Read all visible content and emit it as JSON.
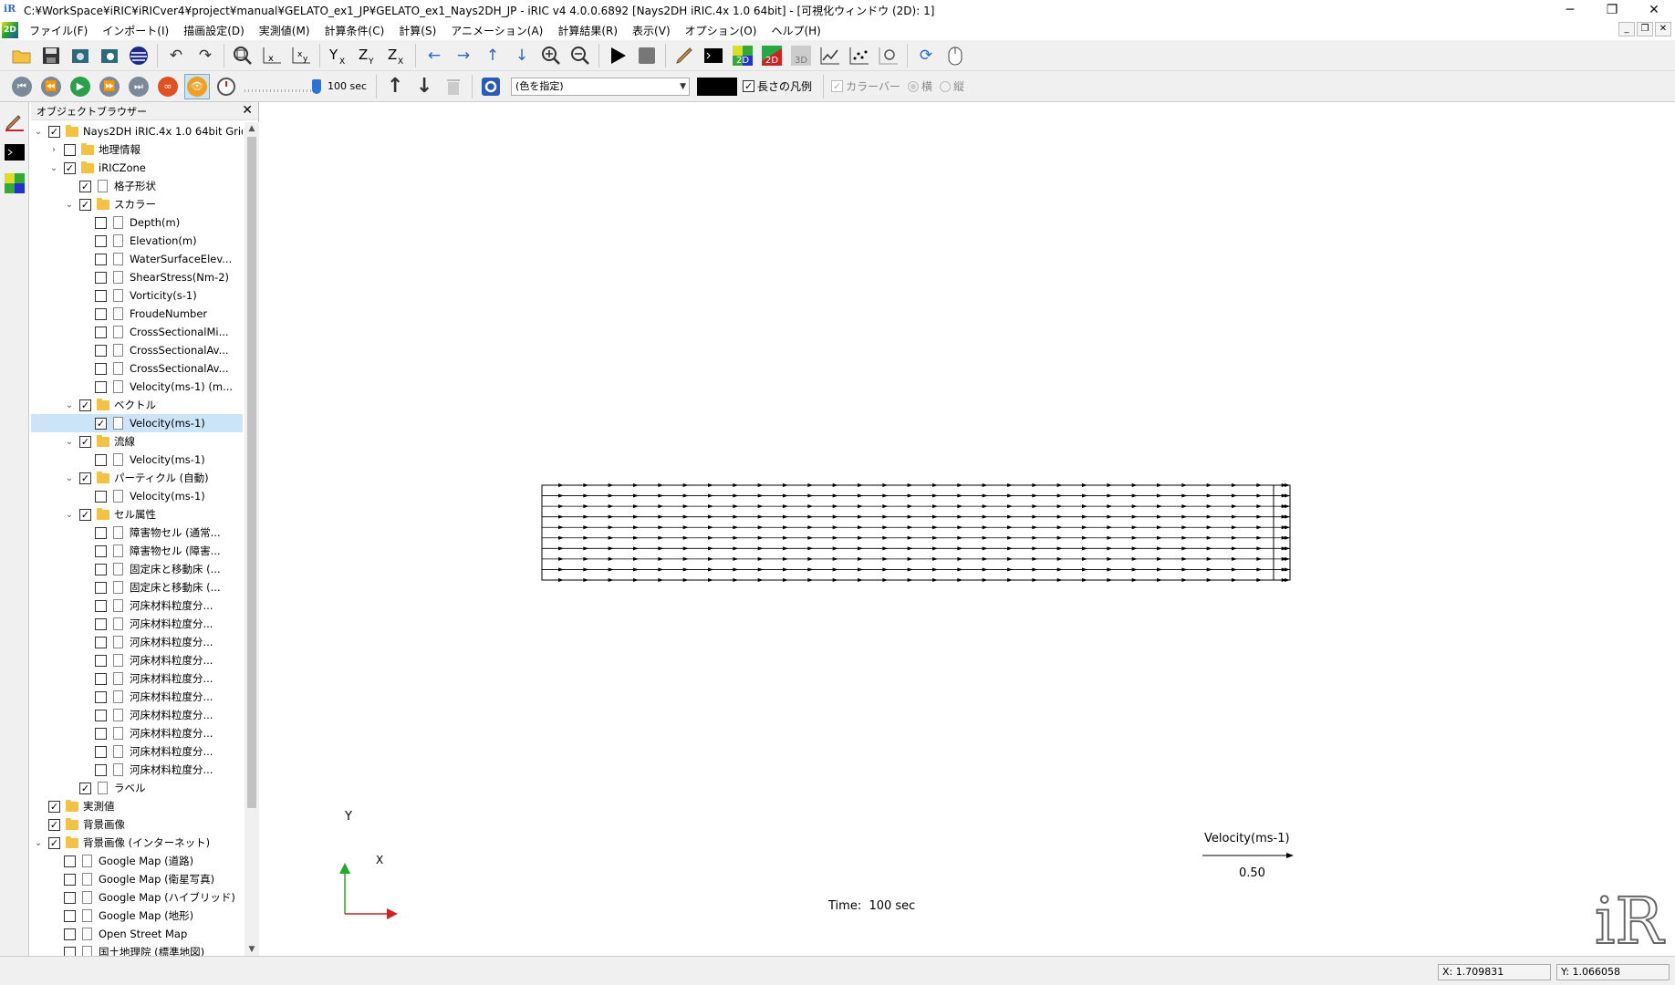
{
  "window": {
    "title": "C:¥WorkSpace¥iRIC¥iRICver4¥project¥manual¥GELATO_ex1_JP¥GELATO_ex1_Nays2DH_JP - iRIC v4 4.0.0.6892 [Nays2DH iRIC.4x 1.0 64bit] - [可視化ウィンドウ (2D): 1]",
    "app_icon": "iR",
    "minimize": "─",
    "maximize": "❐",
    "close": "✕"
  },
  "menu": {
    "logo": "2D",
    "items": [
      "ファイル(F)",
      "インポート(I)",
      "描画設定(D)",
      "実測値(M)",
      "計算条件(C)",
      "計算(S)",
      "アニメーション(A)",
      "計算結果(R)",
      "表示(V)",
      "オプション(O)",
      "ヘルプ(H)"
    ],
    "mdi_minimize": "_",
    "mdi_restore": "❐",
    "mdi_close": "✕"
  },
  "toolbar2": {
    "time_value": "100 sec",
    "color_combo": "(色を指定)",
    "length_legend_label": "長さの凡例",
    "length_legend_checked": true,
    "colorbar_label": "カラーバー",
    "horizontal_label": "横",
    "vertical_label": "縦"
  },
  "browser": {
    "title": "オブジェクトブラウザー",
    "close": "✕",
    "tree": [
      {
        "label": "Nays2DH iRIC.4x 1.0 64bit Grids",
        "level": 0,
        "exp": "⌄",
        "checked": true,
        "type": "folder"
      },
      {
        "label": "地理情報",
        "level": 1,
        "exp": "›",
        "checked": false,
        "type": "folder"
      },
      {
        "label": "iRICZone",
        "level": 1,
        "exp": "⌄",
        "checked": true,
        "type": "folder"
      },
      {
        "label": "格子形状",
        "level": 2,
        "exp": "",
        "checked": true,
        "type": "file"
      },
      {
        "label": "スカラー",
        "level": 2,
        "exp": "⌄",
        "checked": true,
        "type": "folder"
      },
      {
        "label": "Depth(m)",
        "level": 3,
        "exp": "",
        "checked": false,
        "type": "file"
      },
      {
        "label": "Elevation(m)",
        "level": 3,
        "exp": "",
        "checked": false,
        "type": "file"
      },
      {
        "label": "WaterSurfaceElev...",
        "level": 3,
        "exp": "",
        "checked": false,
        "type": "file"
      },
      {
        "label": "ShearStress(Nm-2)",
        "level": 3,
        "exp": "",
        "checked": false,
        "type": "file"
      },
      {
        "label": "Vorticity(s-1)",
        "level": 3,
        "exp": "",
        "checked": false,
        "type": "file"
      },
      {
        "label": "FroudeNumber",
        "level": 3,
        "exp": "",
        "checked": false,
        "type": "file"
      },
      {
        "label": "CrossSectionalMi...",
        "level": 3,
        "exp": "",
        "checked": false,
        "type": "file"
      },
      {
        "label": "CrossSectionalAv...",
        "level": 3,
        "exp": "",
        "checked": false,
        "type": "file"
      },
      {
        "label": "CrossSectionalAv...",
        "level": 3,
        "exp": "",
        "checked": false,
        "type": "file"
      },
      {
        "label": "Velocity(ms-1) (m...",
        "level": 3,
        "exp": "",
        "checked": false,
        "type": "file"
      },
      {
        "label": "ベクトル",
        "level": 2,
        "exp": "⌄",
        "checked": true,
        "type": "folder"
      },
      {
        "label": "Velocity(ms-1)",
        "level": 3,
        "exp": "",
        "checked": true,
        "type": "file",
        "selected": true
      },
      {
        "label": "流線",
        "level": 2,
        "exp": "⌄",
        "checked": true,
        "type": "folder"
      },
      {
        "label": "Velocity(ms-1)",
        "level": 3,
        "exp": "",
        "checked": false,
        "type": "file"
      },
      {
        "label": "パーティクル (自動)",
        "level": 2,
        "exp": "⌄",
        "checked": true,
        "type": "folder"
      },
      {
        "label": "Velocity(ms-1)",
        "level": 3,
        "exp": "",
        "checked": false,
        "type": "file"
      },
      {
        "label": "セル属性",
        "level": 2,
        "exp": "⌄",
        "checked": true,
        "type": "folder"
      },
      {
        "label": "障害物セル (通常...",
        "level": 3,
        "exp": "",
        "checked": false,
        "type": "file"
      },
      {
        "label": "障害物セル (障害...",
        "level": 3,
        "exp": "",
        "checked": false,
        "type": "file"
      },
      {
        "label": "固定床と移動床 (...",
        "level": 3,
        "exp": "",
        "checked": false,
        "type": "file"
      },
      {
        "label": "固定床と移動床 (...",
        "level": 3,
        "exp": "",
        "checked": false,
        "type": "file"
      },
      {
        "label": "河床材料粒度分...",
        "level": 3,
        "exp": "",
        "checked": false,
        "type": "file"
      },
      {
        "label": "河床材料粒度分...",
        "level": 3,
        "exp": "",
        "checked": false,
        "type": "file"
      },
      {
        "label": "河床材料粒度分...",
        "level": 3,
        "exp": "",
        "checked": false,
        "type": "file"
      },
      {
        "label": "河床材料粒度分...",
        "level": 3,
        "exp": "",
        "checked": false,
        "type": "file"
      },
      {
        "label": "河床材料粒度分...",
        "level": 3,
        "exp": "",
        "checked": false,
        "type": "file"
      },
      {
        "label": "河床材料粒度分...",
        "level": 3,
        "exp": "",
        "checked": false,
        "type": "file"
      },
      {
        "label": "河床材料粒度分...",
        "level": 3,
        "exp": "",
        "checked": false,
        "type": "file"
      },
      {
        "label": "河床材料粒度分...",
        "level": 3,
        "exp": "",
        "checked": false,
        "type": "file"
      },
      {
        "label": "河床材料粒度分...",
        "level": 3,
        "exp": "",
        "checked": false,
        "type": "file"
      },
      {
        "label": "河床材料粒度分...",
        "level": 3,
        "exp": "",
        "checked": false,
        "type": "file"
      },
      {
        "label": "ラベル",
        "level": 2,
        "exp": "",
        "checked": true,
        "type": "file"
      },
      {
        "label": "実測値",
        "level": 0,
        "exp": "",
        "checked": true,
        "type": "folder"
      },
      {
        "label": "背景画像",
        "level": 0,
        "exp": "",
        "checked": true,
        "type": "folder"
      },
      {
        "label": "背景画像 (インターネット)",
        "level": 0,
        "exp": "⌄",
        "checked": true,
        "type": "folder"
      },
      {
        "label": "Google Map (道路)",
        "level": 1,
        "exp": "",
        "checked": false,
        "type": "file"
      },
      {
        "label": "Google Map (衛星写真)",
        "level": 1,
        "exp": "",
        "checked": false,
        "type": "file"
      },
      {
        "label": "Google Map (ハイブリッド)",
        "level": 1,
        "exp": "",
        "checked": false,
        "type": "file"
      },
      {
        "label": "Google Map (地形)",
        "level": 1,
        "exp": "",
        "checked": false,
        "type": "file"
      },
      {
        "label": "Open Street Map",
        "level": 1,
        "exp": "",
        "checked": false,
        "type": "file"
      },
      {
        "label": "国土地理院 (標準地図)",
        "level": 1,
        "exp": "",
        "checked": false,
        "type": "file"
      }
    ]
  },
  "canvas": {
    "time_label": "Time:  100 sec",
    "legend_label": "Velocity(ms-1)",
    "legend_value": "0.50",
    "axis_y_label": "Y",
    "axis_x_label": "X",
    "logo": "iRIC",
    "vector_rows": 10,
    "vector_cols": 30
  },
  "status": {
    "x_readout": "X: 1.709831",
    "y_readout": "Y: 1.066058"
  },
  "colors": {
    "axis_y": "#22aa22",
    "axis_x": "#cc2222",
    "selection": "#cce4f7"
  }
}
